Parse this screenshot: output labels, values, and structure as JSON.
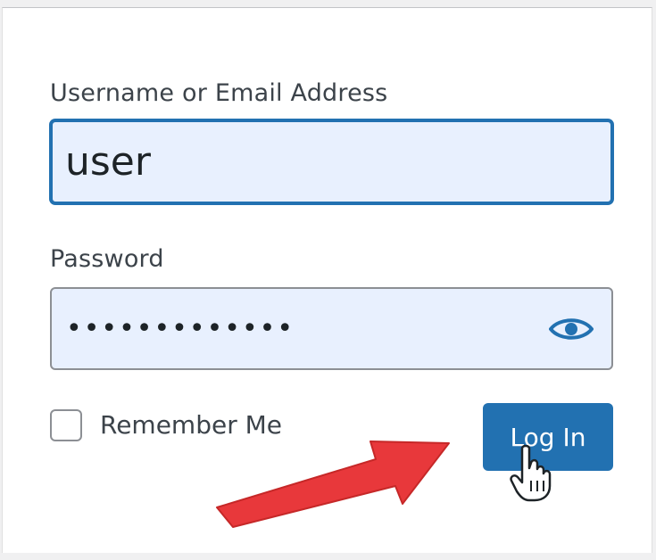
{
  "form": {
    "username": {
      "label": "Username or Email Address",
      "value": "user"
    },
    "password": {
      "label": "Password",
      "value": "•••••••••••••",
      "toggle_icon": "eye-icon"
    },
    "remember": {
      "label": "Remember Me",
      "checked": false
    },
    "submit": {
      "label": "Log In"
    }
  },
  "colors": {
    "accent": "#2271b1",
    "input_background": "#e8f0fe",
    "annotation_arrow": "#e8383b"
  }
}
